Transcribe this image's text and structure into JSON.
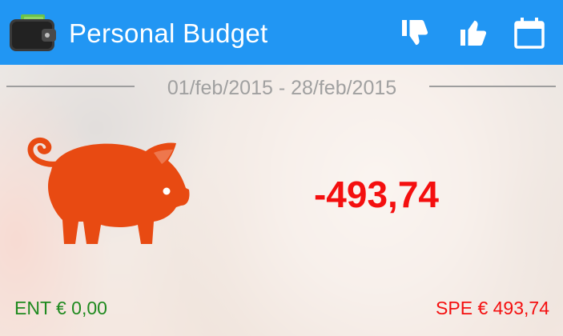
{
  "app": {
    "title": "Personal Budget",
    "logo_icon": "wallet-icon"
  },
  "actions": [
    {
      "icon": "thumbs-down-icon"
    },
    {
      "icon": "thumbs-up-icon"
    },
    {
      "icon": "calendar-icon"
    }
  ],
  "period": {
    "range": "01/feb/2015 - 28/feb/2015"
  },
  "summary": {
    "balance": "-493,74",
    "income_label": "ENT € 0,00",
    "expense_label": "SPE € 493,74",
    "pig_icon": "piggy-bank-icon"
  },
  "colors": {
    "header": "#2196f3",
    "negative": "#f40f0f",
    "positive": "#1f8a1f",
    "pig": "#e84a12",
    "muted": "#a0a0a0"
  }
}
